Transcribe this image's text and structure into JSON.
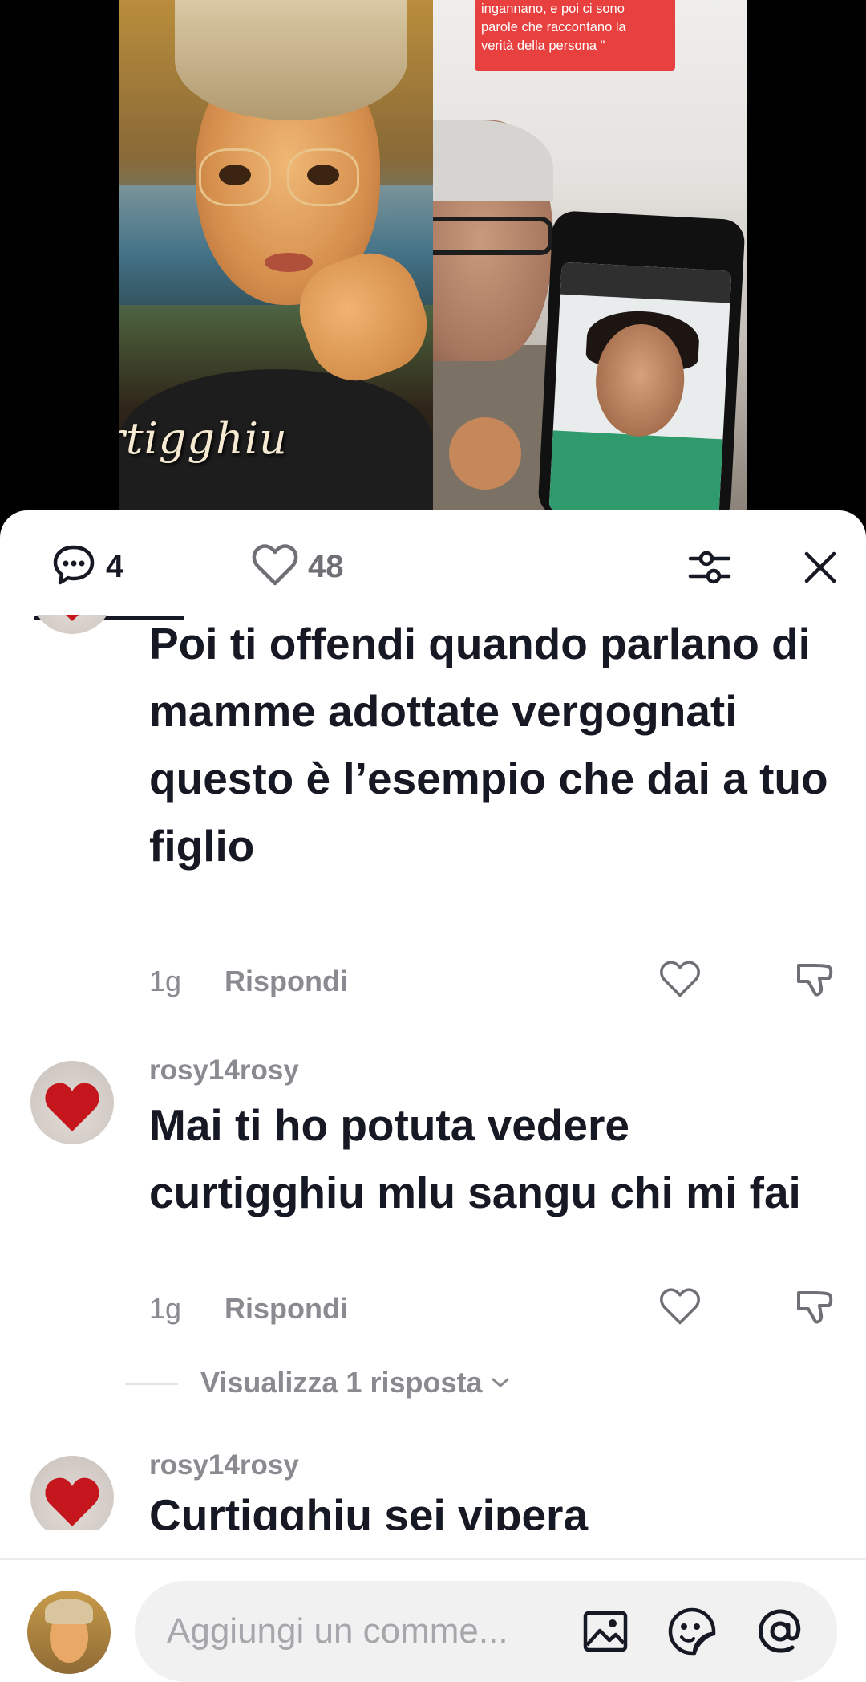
{
  "video": {
    "left_caption": "rtigghiu",
    "sticker_lines": [
      "ingannano, e poi ci sono",
      "parole che raccontano la",
      "verità della persona \""
    ]
  },
  "header": {
    "comment_count": "4",
    "like_count": "48",
    "icons": [
      "comment-icon",
      "heart-icon",
      "filter-icon",
      "close-icon"
    ]
  },
  "comments": [
    {
      "text": "Poi ti offendi quando parlano di mamme adottate vergognati questo è l’esempio che dai a tuo figlio",
      "time": "1g",
      "reply_label": "Rispondi"
    },
    {
      "username": "rosy14rosy",
      "text": "Mai ti ho potuta vedere curtigghiu mlu sangu chi mi fai",
      "time": "1g",
      "reply_label": "Rispondi",
      "view_replies": "Visualizza 1 risposta"
    },
    {
      "username": "rosy14rosy",
      "text": "Curtigghiu sei vipera"
    }
  ],
  "composer": {
    "placeholder": "Aggiungi un comme..."
  },
  "colors": {
    "text_primary": "#161823",
    "text_secondary": "#8a8b91",
    "avatar_heart": "#c4161c"
  }
}
